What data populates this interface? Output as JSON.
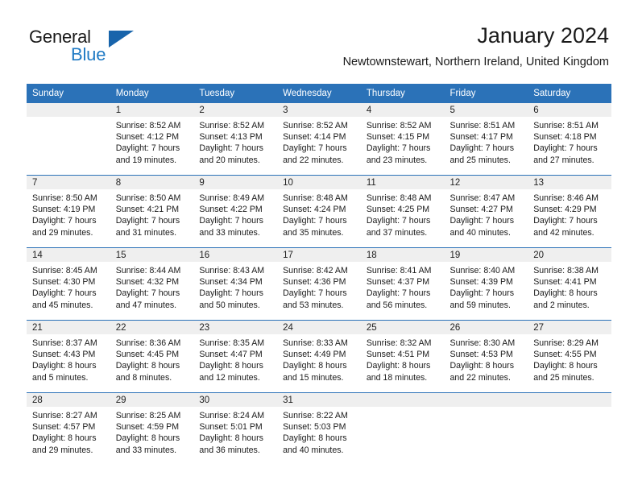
{
  "brand": {
    "name_line1": "General",
    "name_line2": "Blue",
    "accent_color": "#1864ab",
    "blue_text_color": "#1f7ac4"
  },
  "header": {
    "title": "January 2024",
    "subtitle": "Newtownstewart, Northern Ireland, United Kingdom"
  },
  "theme": {
    "header_row_background": "#2b72b8",
    "header_row_text": "#ffffff",
    "daynumber_band_background": "#efefef",
    "cell_border_top": "#2b72b8"
  },
  "calendar": {
    "weekday_headers": [
      "Sunday",
      "Monday",
      "Tuesday",
      "Wednesday",
      "Thursday",
      "Friday",
      "Saturday"
    ],
    "weeks": [
      [
        {
          "day": "",
          "sunrise": "",
          "sunset": "",
          "daylight_line1": "",
          "daylight_line2": "",
          "empty": true
        },
        {
          "day": "1",
          "sunrise": "Sunrise: 8:52 AM",
          "sunset": "Sunset: 4:12 PM",
          "daylight_line1": "Daylight: 7 hours",
          "daylight_line2": "and 19 minutes.",
          "empty": false
        },
        {
          "day": "2",
          "sunrise": "Sunrise: 8:52 AM",
          "sunset": "Sunset: 4:13 PM",
          "daylight_line1": "Daylight: 7 hours",
          "daylight_line2": "and 20 minutes.",
          "empty": false
        },
        {
          "day": "3",
          "sunrise": "Sunrise: 8:52 AM",
          "sunset": "Sunset: 4:14 PM",
          "daylight_line1": "Daylight: 7 hours",
          "daylight_line2": "and 22 minutes.",
          "empty": false
        },
        {
          "day": "4",
          "sunrise": "Sunrise: 8:52 AM",
          "sunset": "Sunset: 4:15 PM",
          "daylight_line1": "Daylight: 7 hours",
          "daylight_line2": "and 23 minutes.",
          "empty": false
        },
        {
          "day": "5",
          "sunrise": "Sunrise: 8:51 AM",
          "sunset": "Sunset: 4:17 PM",
          "daylight_line1": "Daylight: 7 hours",
          "daylight_line2": "and 25 minutes.",
          "empty": false
        },
        {
          "day": "6",
          "sunrise": "Sunrise: 8:51 AM",
          "sunset": "Sunset: 4:18 PM",
          "daylight_line1": "Daylight: 7 hours",
          "daylight_line2": "and 27 minutes.",
          "empty": false
        }
      ],
      [
        {
          "day": "7",
          "sunrise": "Sunrise: 8:50 AM",
          "sunset": "Sunset: 4:19 PM",
          "daylight_line1": "Daylight: 7 hours",
          "daylight_line2": "and 29 minutes.",
          "empty": false
        },
        {
          "day": "8",
          "sunrise": "Sunrise: 8:50 AM",
          "sunset": "Sunset: 4:21 PM",
          "daylight_line1": "Daylight: 7 hours",
          "daylight_line2": "and 31 minutes.",
          "empty": false
        },
        {
          "day": "9",
          "sunrise": "Sunrise: 8:49 AM",
          "sunset": "Sunset: 4:22 PM",
          "daylight_line1": "Daylight: 7 hours",
          "daylight_line2": "and 33 minutes.",
          "empty": false
        },
        {
          "day": "10",
          "sunrise": "Sunrise: 8:48 AM",
          "sunset": "Sunset: 4:24 PM",
          "daylight_line1": "Daylight: 7 hours",
          "daylight_line2": "and 35 minutes.",
          "empty": false
        },
        {
          "day": "11",
          "sunrise": "Sunrise: 8:48 AM",
          "sunset": "Sunset: 4:25 PM",
          "daylight_line1": "Daylight: 7 hours",
          "daylight_line2": "and 37 minutes.",
          "empty": false
        },
        {
          "day": "12",
          "sunrise": "Sunrise: 8:47 AM",
          "sunset": "Sunset: 4:27 PM",
          "daylight_line1": "Daylight: 7 hours",
          "daylight_line2": "and 40 minutes.",
          "empty": false
        },
        {
          "day": "13",
          "sunrise": "Sunrise: 8:46 AM",
          "sunset": "Sunset: 4:29 PM",
          "daylight_line1": "Daylight: 7 hours",
          "daylight_line2": "and 42 minutes.",
          "empty": false
        }
      ],
      [
        {
          "day": "14",
          "sunrise": "Sunrise: 8:45 AM",
          "sunset": "Sunset: 4:30 PM",
          "daylight_line1": "Daylight: 7 hours",
          "daylight_line2": "and 45 minutes.",
          "empty": false
        },
        {
          "day": "15",
          "sunrise": "Sunrise: 8:44 AM",
          "sunset": "Sunset: 4:32 PM",
          "daylight_line1": "Daylight: 7 hours",
          "daylight_line2": "and 47 minutes.",
          "empty": false
        },
        {
          "day": "16",
          "sunrise": "Sunrise: 8:43 AM",
          "sunset": "Sunset: 4:34 PM",
          "daylight_line1": "Daylight: 7 hours",
          "daylight_line2": "and 50 minutes.",
          "empty": false
        },
        {
          "day": "17",
          "sunrise": "Sunrise: 8:42 AM",
          "sunset": "Sunset: 4:36 PM",
          "daylight_line1": "Daylight: 7 hours",
          "daylight_line2": "and 53 minutes.",
          "empty": false
        },
        {
          "day": "18",
          "sunrise": "Sunrise: 8:41 AM",
          "sunset": "Sunset: 4:37 PM",
          "daylight_line1": "Daylight: 7 hours",
          "daylight_line2": "and 56 minutes.",
          "empty": false
        },
        {
          "day": "19",
          "sunrise": "Sunrise: 8:40 AM",
          "sunset": "Sunset: 4:39 PM",
          "daylight_line1": "Daylight: 7 hours",
          "daylight_line2": "and 59 minutes.",
          "empty": false
        },
        {
          "day": "20",
          "sunrise": "Sunrise: 8:38 AM",
          "sunset": "Sunset: 4:41 PM",
          "daylight_line1": "Daylight: 8 hours",
          "daylight_line2": "and 2 minutes.",
          "empty": false
        }
      ],
      [
        {
          "day": "21",
          "sunrise": "Sunrise: 8:37 AM",
          "sunset": "Sunset: 4:43 PM",
          "daylight_line1": "Daylight: 8 hours",
          "daylight_line2": "and 5 minutes.",
          "empty": false
        },
        {
          "day": "22",
          "sunrise": "Sunrise: 8:36 AM",
          "sunset": "Sunset: 4:45 PM",
          "daylight_line1": "Daylight: 8 hours",
          "daylight_line2": "and 8 minutes.",
          "empty": false
        },
        {
          "day": "23",
          "sunrise": "Sunrise: 8:35 AM",
          "sunset": "Sunset: 4:47 PM",
          "daylight_line1": "Daylight: 8 hours",
          "daylight_line2": "and 12 minutes.",
          "empty": false
        },
        {
          "day": "24",
          "sunrise": "Sunrise: 8:33 AM",
          "sunset": "Sunset: 4:49 PM",
          "daylight_line1": "Daylight: 8 hours",
          "daylight_line2": "and 15 minutes.",
          "empty": false
        },
        {
          "day": "25",
          "sunrise": "Sunrise: 8:32 AM",
          "sunset": "Sunset: 4:51 PM",
          "daylight_line1": "Daylight: 8 hours",
          "daylight_line2": "and 18 minutes.",
          "empty": false
        },
        {
          "day": "26",
          "sunrise": "Sunrise: 8:30 AM",
          "sunset": "Sunset: 4:53 PM",
          "daylight_line1": "Daylight: 8 hours",
          "daylight_line2": "and 22 minutes.",
          "empty": false
        },
        {
          "day": "27",
          "sunrise": "Sunrise: 8:29 AM",
          "sunset": "Sunset: 4:55 PM",
          "daylight_line1": "Daylight: 8 hours",
          "daylight_line2": "and 25 minutes.",
          "empty": false
        }
      ],
      [
        {
          "day": "28",
          "sunrise": "Sunrise: 8:27 AM",
          "sunset": "Sunset: 4:57 PM",
          "daylight_line1": "Daylight: 8 hours",
          "daylight_line2": "and 29 minutes.",
          "empty": false
        },
        {
          "day": "29",
          "sunrise": "Sunrise: 8:25 AM",
          "sunset": "Sunset: 4:59 PM",
          "daylight_line1": "Daylight: 8 hours",
          "daylight_line2": "and 33 minutes.",
          "empty": false
        },
        {
          "day": "30",
          "sunrise": "Sunrise: 8:24 AM",
          "sunset": "Sunset: 5:01 PM",
          "daylight_line1": "Daylight: 8 hours",
          "daylight_line2": "and 36 minutes.",
          "empty": false
        },
        {
          "day": "31",
          "sunrise": "Sunrise: 8:22 AM",
          "sunset": "Sunset: 5:03 PM",
          "daylight_line1": "Daylight: 8 hours",
          "daylight_line2": "and 40 minutes.",
          "empty": false
        },
        {
          "day": "",
          "sunrise": "",
          "sunset": "",
          "daylight_line1": "",
          "daylight_line2": "",
          "empty": true
        },
        {
          "day": "",
          "sunrise": "",
          "sunset": "",
          "daylight_line1": "",
          "daylight_line2": "",
          "empty": true
        },
        {
          "day": "",
          "sunrise": "",
          "sunset": "",
          "daylight_line1": "",
          "daylight_line2": "",
          "empty": true
        }
      ]
    ]
  }
}
